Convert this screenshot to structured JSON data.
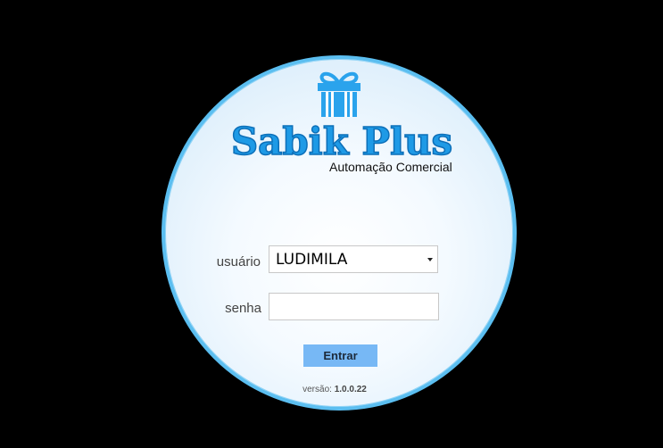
{
  "logo": {
    "brand": "Sabik Plus",
    "subtitle": "Automação Comercial",
    "icon": "gift-icon"
  },
  "form": {
    "user_label": "usuário",
    "user_value": "LUDIMILA",
    "password_label": "senha",
    "password_value": "",
    "submit_label": "Entrar"
  },
  "footer": {
    "version_label": "versão:",
    "version_value": "1.0.0.22"
  },
  "colors": {
    "background": "#000000",
    "circle_border": "#5bbef0",
    "brand_blue": "#1e9ae6",
    "button": "#77b8f5"
  }
}
